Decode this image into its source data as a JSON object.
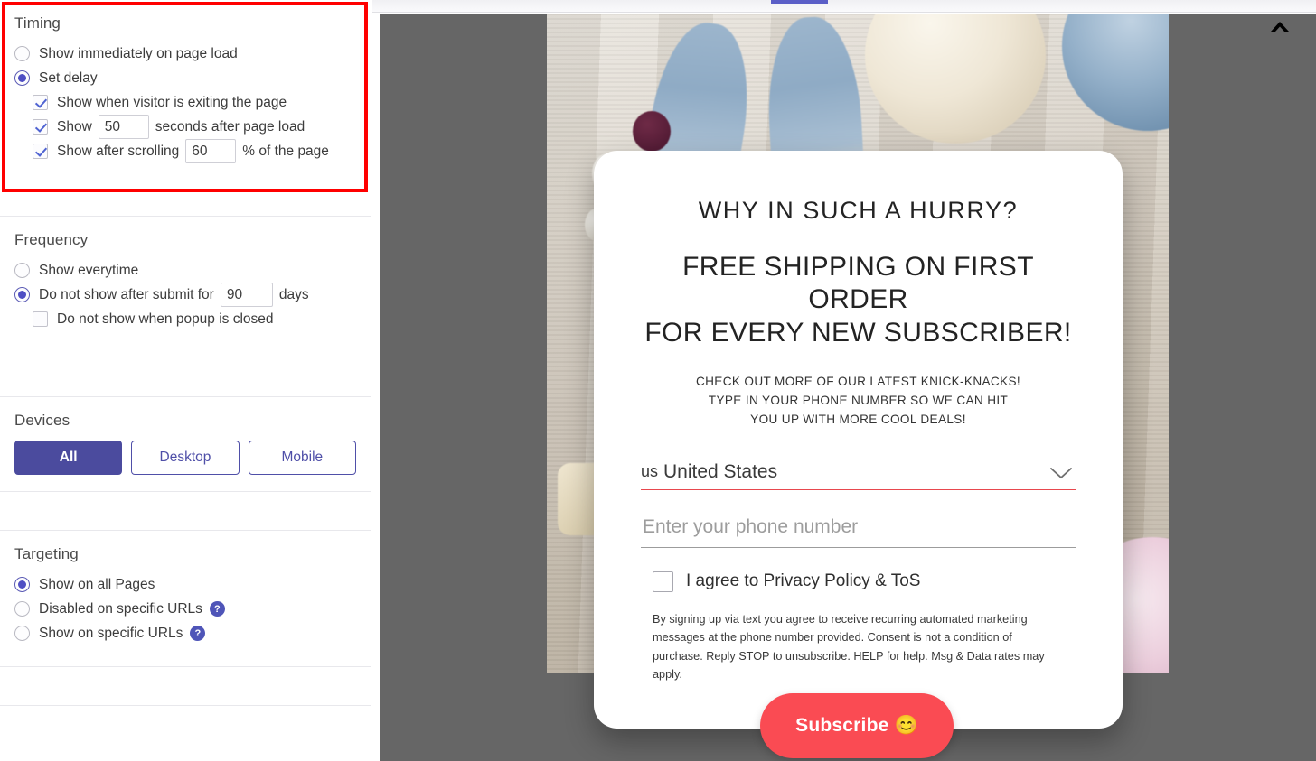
{
  "settings": {
    "timing": {
      "title": "Timing",
      "options": [
        {
          "label": "Show immediately on page load",
          "type": "radio",
          "checked": false
        },
        {
          "label": "Set delay",
          "type": "radio",
          "checked": true
        }
      ],
      "delay_options": [
        {
          "label": "Show when visitor is exiting the page",
          "checked": true
        },
        {
          "label_before": "Show",
          "value": "50",
          "label_after": "seconds after page load",
          "checked": true
        },
        {
          "label_before": "Show after scrolling",
          "value": "60",
          "label_after": "% of the page",
          "checked": true
        }
      ]
    },
    "frequency": {
      "title": "Frequency",
      "options": [
        {
          "label": "Show everytime",
          "type": "radio",
          "checked": false
        },
        {
          "label_before": "Do not show after submit for",
          "value": "90",
          "label_after": "days",
          "type": "radio",
          "checked": true
        },
        {
          "label": "Do not show when popup is closed",
          "type": "checkbox",
          "checked": false
        }
      ]
    },
    "devices": {
      "title": "Devices",
      "buttons": [
        {
          "label": "All",
          "active": true
        },
        {
          "label": "Desktop",
          "active": false
        },
        {
          "label": "Mobile",
          "active": false
        }
      ]
    },
    "targeting": {
      "title": "Targeting",
      "options": [
        {
          "label": "Show on all Pages",
          "checked": true,
          "help": false
        },
        {
          "label": "Disabled on specific URLs",
          "checked": false,
          "help": true
        },
        {
          "label": "Show on specific URLs",
          "checked": false,
          "help": true
        }
      ],
      "help_glyph": "?"
    },
    "highlight_color": "#ff0000",
    "accent_color": "#4b4b9e"
  },
  "preview": {
    "collapse_icon": "chevron-up-icon",
    "popup": {
      "headline": "WHY IN SUCH A HURRY?",
      "subheadline_line1": "FREE SHIPPING ON FIRST ORDER",
      "subheadline_line2": "FOR EVERY NEW SUBSCRIBER!",
      "body_line1": "CHECK OUT MORE OF OUR LATEST KNICK-KNACKS!",
      "body_line2": "TYPE IN YOUR PHONE NUMBER SO WE CAN HIT",
      "body_line3": "YOU UP WITH MORE COOL DEALS!",
      "country": {
        "flag_text": "us",
        "name": "United States",
        "chevron": "chevron-down-icon"
      },
      "phone_placeholder": "Enter your phone number",
      "phone_value": "",
      "agree_label": "I agree to Privacy Policy & ToS",
      "agree_checked": false,
      "fineprint": "By signing up via text you agree to receive recurring automated marketing messages at the phone number provided. Consent is not a condition of purchase. Reply STOP to unsubscribe. HELP for help. Msg & Data rates may apply.",
      "subscribe_label": "Subscribe 😊",
      "button_color": "#fa4b53",
      "underline_color": "#e8474e"
    }
  }
}
